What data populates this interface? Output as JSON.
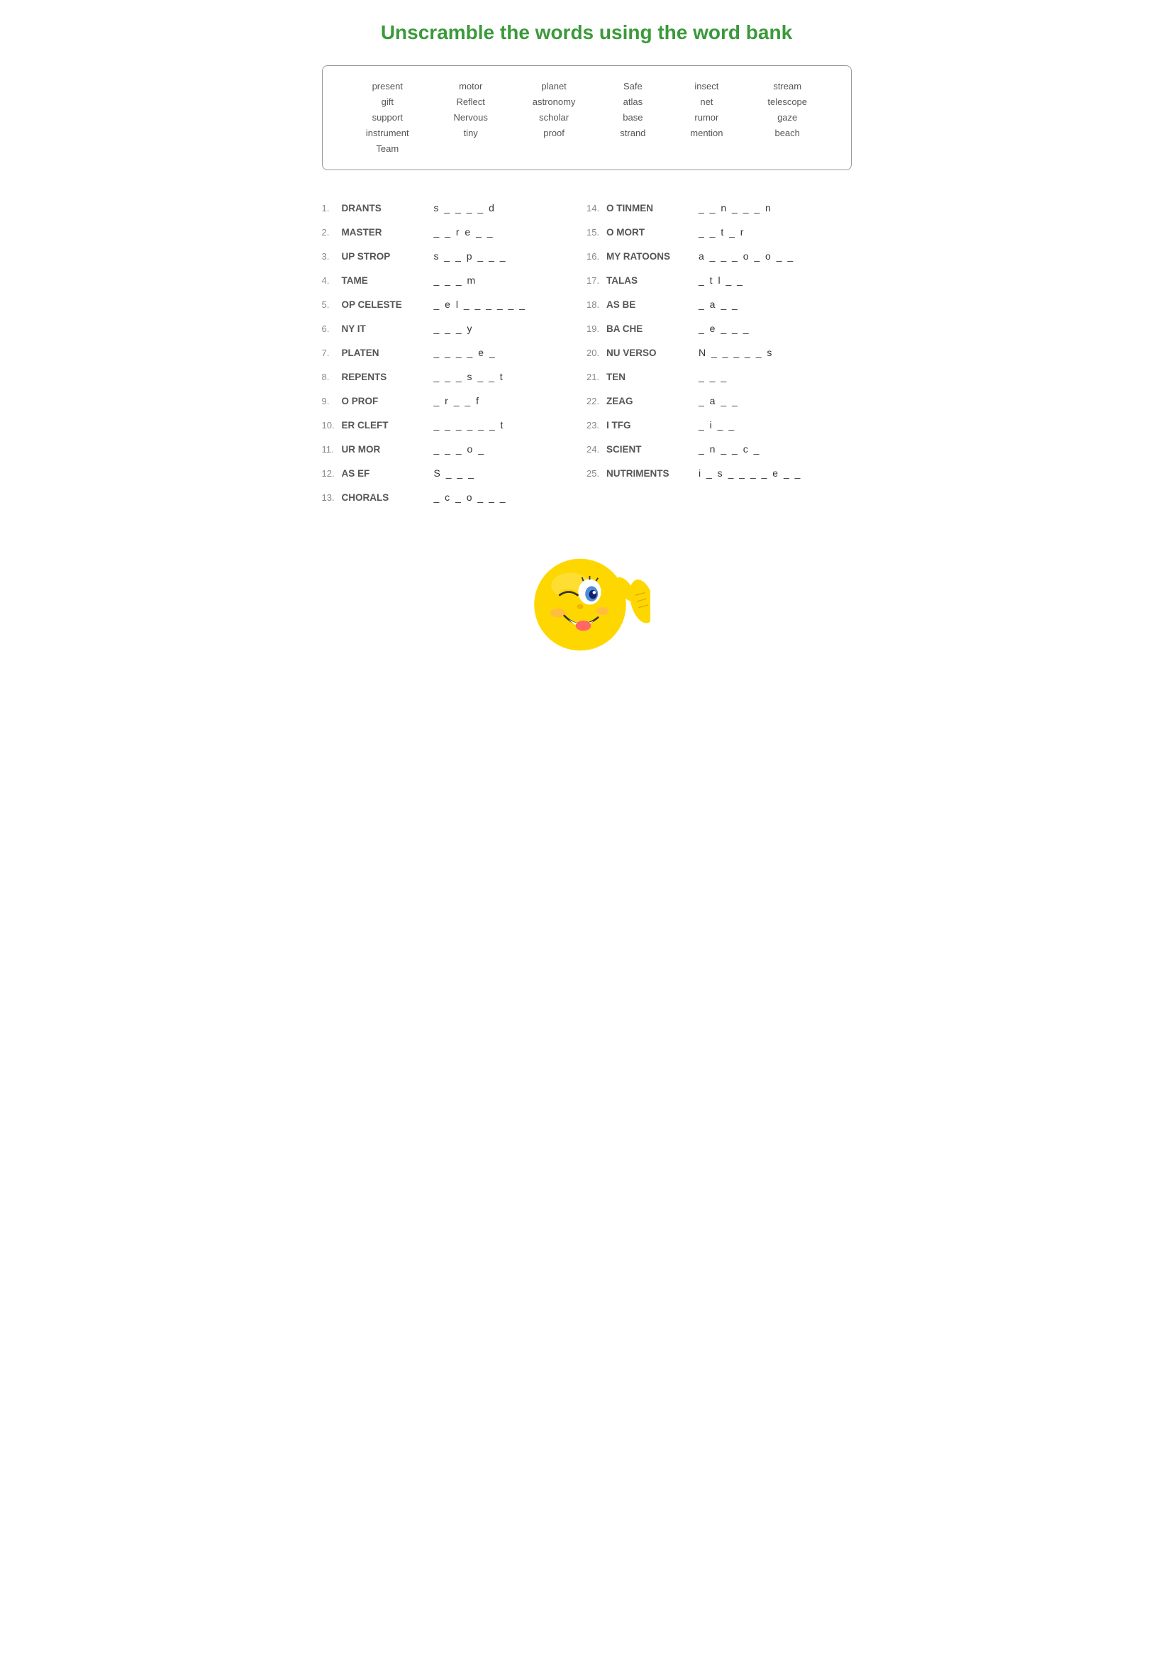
{
  "title": "Unscramble the words using  the word bank",
  "wordBank": {
    "col1": [
      "present",
      "gift",
      "support",
      "instrument",
      "Team"
    ],
    "col2": [
      "motor",
      "Reflect",
      "Nervous",
      "tiny"
    ],
    "col3": [
      "planet",
      "astronomy",
      "scholar",
      "proof"
    ],
    "col4": [
      "Safe",
      "atlas",
      "base",
      "strand"
    ],
    "col5": [
      "insect",
      "net",
      "rumor",
      "mention"
    ],
    "col6": [
      "stream",
      "telescope",
      "gaze",
      "beach"
    ]
  },
  "puzzles": [
    {
      "num": "1.",
      "scrambled": "DRANTS",
      "answer": "s _ _ _ _ d"
    },
    {
      "num": "2.",
      "scrambled": "MASTER",
      "answer": "_ _ r e _ _"
    },
    {
      "num": "3.",
      "scrambled": "UP STROP",
      "answer": "s _ _ p _ _ _"
    },
    {
      "num": "4.",
      "scrambled": "TAME",
      "answer": "_ _ _ m"
    },
    {
      "num": "5.",
      "scrambled": "OP CELESTE",
      "answer": "_ e l _ _ _ _ _ _"
    },
    {
      "num": "6.",
      "scrambled": "NY IT",
      "answer": "_ _ _ y"
    },
    {
      "num": "7.",
      "scrambled": "PLATEN",
      "answer": "_ _ _ _ e _"
    },
    {
      "num": "8.",
      "scrambled": "REPENTS",
      "answer": "_ _ _ s _ _ t"
    },
    {
      "num": "9.",
      "scrambled": "O PROF",
      "answer": "_ r _ _ f"
    },
    {
      "num": "10.",
      "scrambled": "ER CLEFT",
      "answer": "_ _ _ _ _ _ t"
    },
    {
      "num": "11.",
      "scrambled": "UR MOR",
      "answer": "_ _ _ o _"
    },
    {
      "num": "12.",
      "scrambled": "AS EF",
      "answer": "S _ _ _"
    },
    {
      "num": "13.",
      "scrambled": "CHORALS",
      "answer": "_ c _ o _ _ _"
    },
    {
      "num": "14.",
      "scrambled": "O TINMEN",
      "answer": "_ _ n _ _ _ n"
    },
    {
      "num": "15.",
      "scrambled": "O MORT",
      "answer": "_ _ t _ r"
    },
    {
      "num": "16.",
      "scrambled": "MY RATOONS",
      "answer": "a _ _ _ o _ o _ _"
    },
    {
      "num": "17.",
      "scrambled": "TALAS",
      "answer": "_ t l _ _"
    },
    {
      "num": "18.",
      "scrambled": "AS BE",
      "answer": "_ a _ _"
    },
    {
      "num": "19.",
      "scrambled": "BA CHE",
      "answer": "_ e _ _ _"
    },
    {
      "num": "20.",
      "scrambled": "NU VERSO",
      "answer": "N _ _ _ _ _ s"
    },
    {
      "num": "21.",
      "scrambled": "TEN",
      "answer": "_ _ _"
    },
    {
      "num": "22.",
      "scrambled": "ZEAG",
      "answer": "_ a _ _"
    },
    {
      "num": "23.",
      "scrambled": "I TFG",
      "answer": "_ i _ _"
    },
    {
      "num": "24.",
      "scrambled": "SCIENT",
      "answer": "_ n _ _ c _"
    },
    {
      "num": "25.",
      "scrambled": "NUTRIMENTS",
      "answer": "i _ s _ _ _ _ e _ _"
    }
  ]
}
